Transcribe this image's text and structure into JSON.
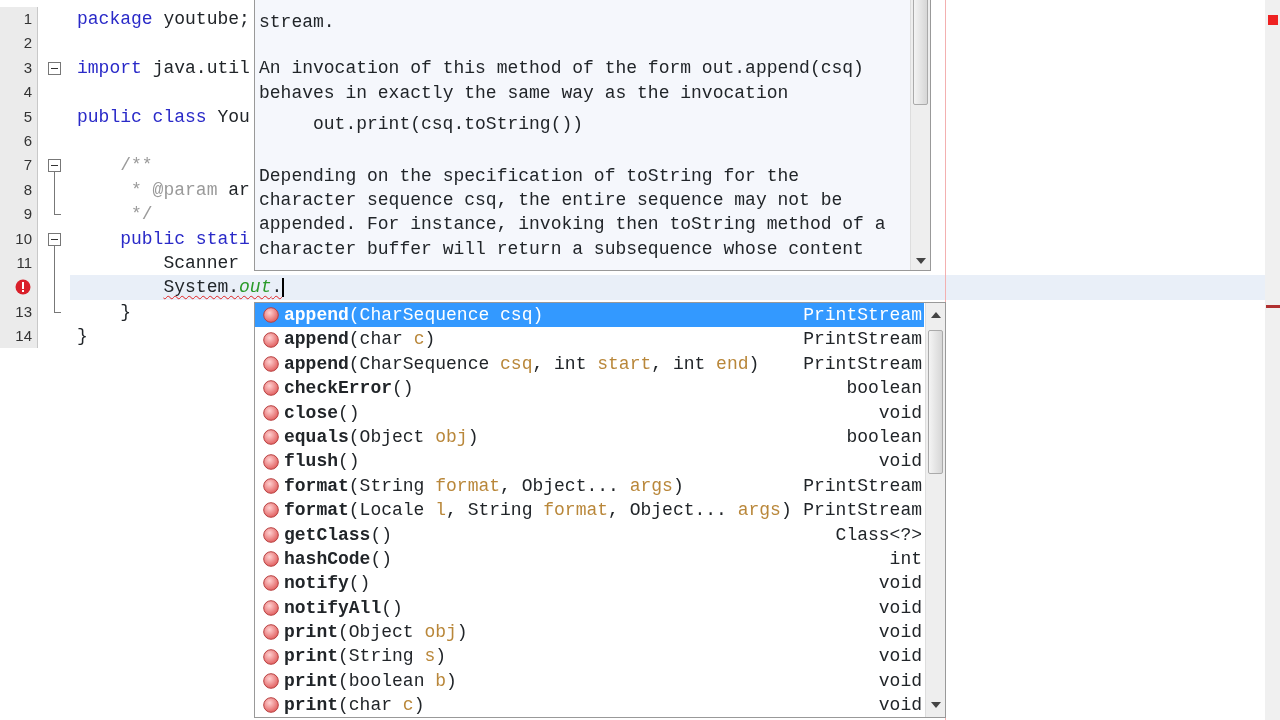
{
  "editor": {
    "lines": [
      {
        "number": "1",
        "tokens": [
          {
            "t": "package",
            "keyword": true
          },
          {
            "t": " youtube;"
          }
        ]
      },
      {
        "number": "2"
      },
      {
        "number": "3",
        "fold_toggle": true,
        "tokens": [
          {
            "t": "import",
            "keyword": true
          },
          {
            "t": " java.util"
          }
        ]
      },
      {
        "number": "4"
      },
      {
        "number": "5",
        "tokens": [
          {
            "t": "public class",
            "keyword": true
          },
          {
            "t": " You"
          }
        ]
      },
      {
        "number": "6"
      },
      {
        "number": "7",
        "fold_toggle": true,
        "fold_guide": true,
        "tokens": [
          {
            "t": "    /**",
            "comment": true
          }
        ]
      },
      {
        "number": "8",
        "fold_guide": true,
        "tokens": [
          {
            "t": "     * @param ",
            "comment": true
          },
          {
            "t": "ar"
          }
        ]
      },
      {
        "number": "9",
        "fold_end": true,
        "tokens": [
          {
            "t": "     */",
            "comment": true
          }
        ]
      },
      {
        "number": "10",
        "fold_toggle": true,
        "fold_guide": true,
        "tokens": [
          {
            "t": "    public stati",
            "keyword": true
          }
        ]
      },
      {
        "number": "11",
        "fold_guide": true,
        "tokens": [
          {
            "t": "        Scanner"
          }
        ]
      },
      {
        "error": true,
        "current": true,
        "fold_guide": true,
        "tokens": [
          {
            "t": "        System.",
            "squiggle": true
          },
          {
            "t": "out",
            "field": true,
            "squiggle": true
          },
          {
            "t": ".",
            "squiggle": true
          }
        ]
      },
      {
        "number": "13",
        "fold_end": true,
        "tokens": [
          {
            "t": "    }"
          }
        ]
      },
      {
        "number": "14",
        "tokens": [
          {
            "t": "}"
          }
        ]
      }
    ]
  },
  "javadoc": {
    "paragraphs": [
      {
        "code_sample": false,
        "lines": [
          "stream."
        ]
      },
      {
        "code_sample": false,
        "lines": [
          "An invocation of this method of the form out.append(csq)",
          "behaves in exactly the same way as the invocation"
        ]
      },
      {
        "code_sample": true,
        "lines": [
          "out.print(csq.toString())"
        ]
      },
      {
        "code_sample": false,
        "lines": [
          "Depending on the specification of toString for the",
          "character sequence csq, the entire sequence may not be",
          "appended. For instance, invoking then toString method of a",
          "character buffer will return a subsequence whose content"
        ]
      }
    ]
  },
  "completion": {
    "items": [
      {
        "parts": [
          "append",
          "(CharSequence ",
          "csq",
          ")"
        ],
        "returns": "PrintStream",
        "selected": true
      },
      {
        "parts": [
          "append",
          "(char ",
          "c",
          ")"
        ],
        "returns": "PrintStream",
        "selected": false
      },
      {
        "parts": [
          "append",
          "(CharSequence ",
          "csq",
          ", int ",
          "start",
          ", int ",
          "end",
          ")"
        ],
        "returns": "PrintStream",
        "selected": false
      },
      {
        "parts": [
          "checkError",
          "()"
        ],
        "returns": "boolean",
        "selected": false
      },
      {
        "parts": [
          "close",
          "()"
        ],
        "returns": "void",
        "selected": false
      },
      {
        "parts": [
          "equals",
          "(Object ",
          "obj",
          ")"
        ],
        "returns": "boolean",
        "selected": false
      },
      {
        "parts": [
          "flush",
          "()"
        ],
        "returns": "void",
        "selected": false
      },
      {
        "parts": [
          "format",
          "(String ",
          "format",
          ", Object... ",
          "args",
          ")"
        ],
        "returns": "PrintStream",
        "selected": false
      },
      {
        "parts": [
          "format",
          "(Locale ",
          "l",
          ", String ",
          "format",
          ", Object... ",
          "args",
          ")"
        ],
        "returns": "PrintStream",
        "selected": false
      },
      {
        "parts": [
          "getClass",
          "()"
        ],
        "returns": "Class<?>",
        "selected": false
      },
      {
        "parts": [
          "hashCode",
          "()"
        ],
        "returns": "int",
        "selected": false
      },
      {
        "parts": [
          "notify",
          "()"
        ],
        "returns": "void",
        "selected": false
      },
      {
        "parts": [
          "notifyAll",
          "()"
        ],
        "returns": "void",
        "selected": false
      },
      {
        "parts": [
          "print",
          "(Object ",
          "obj",
          ")"
        ],
        "returns": "void",
        "selected": false
      },
      {
        "parts": [
          "print",
          "(String ",
          "s",
          ")"
        ],
        "returns": "void",
        "selected": false
      },
      {
        "parts": [
          "print",
          "(boolean ",
          "b",
          ")"
        ],
        "returns": "void",
        "selected": false
      },
      {
        "parts": [
          "print",
          "(char ",
          "c",
          ")"
        ],
        "returns": "void",
        "selected": false
      }
    ]
  }
}
